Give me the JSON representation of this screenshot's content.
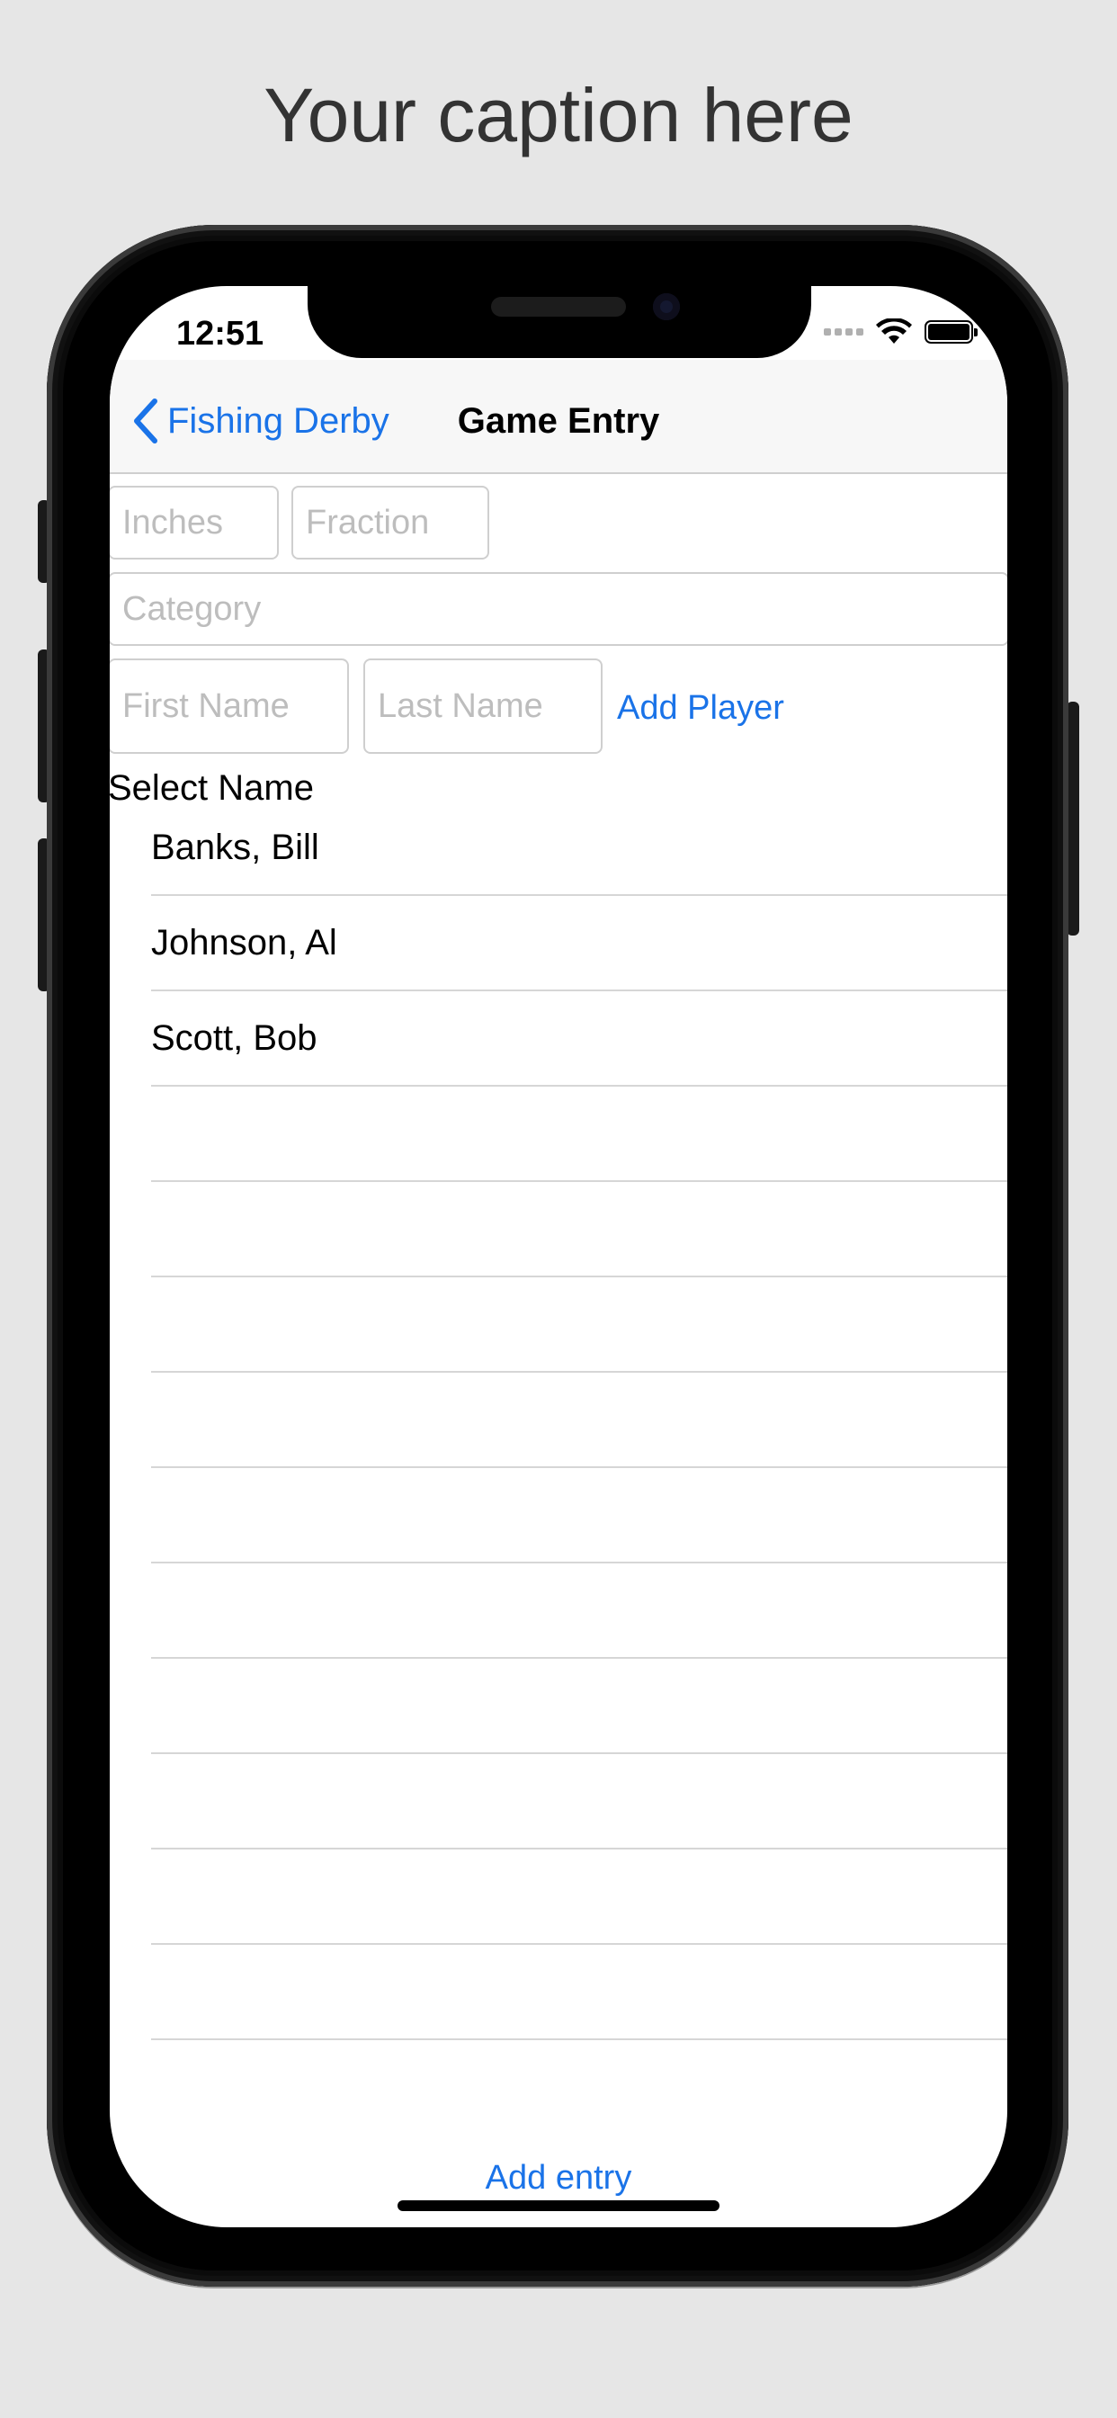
{
  "caption": "Your caption here",
  "status_bar": {
    "time": "12:51"
  },
  "nav": {
    "back_label": "Fishing Derby",
    "title": "Game Entry"
  },
  "form": {
    "inches_placeholder": "Inches",
    "fraction_placeholder": "Fraction",
    "category_placeholder": "Category",
    "first_name_placeholder": "First Name",
    "last_name_placeholder": "Last Name",
    "add_player_label": "Add Player"
  },
  "select_name_label": "Select Name",
  "players": [
    {
      "name": "Banks, Bill"
    },
    {
      "name": "Johnson, Al"
    },
    {
      "name": "Scott, Bob"
    }
  ],
  "empty_rows": 10,
  "add_entry_label": "Add entry",
  "colors": {
    "accent": "#1a73e8",
    "separator": "#d6d6d6",
    "placeholder": "#bdbdbd"
  }
}
